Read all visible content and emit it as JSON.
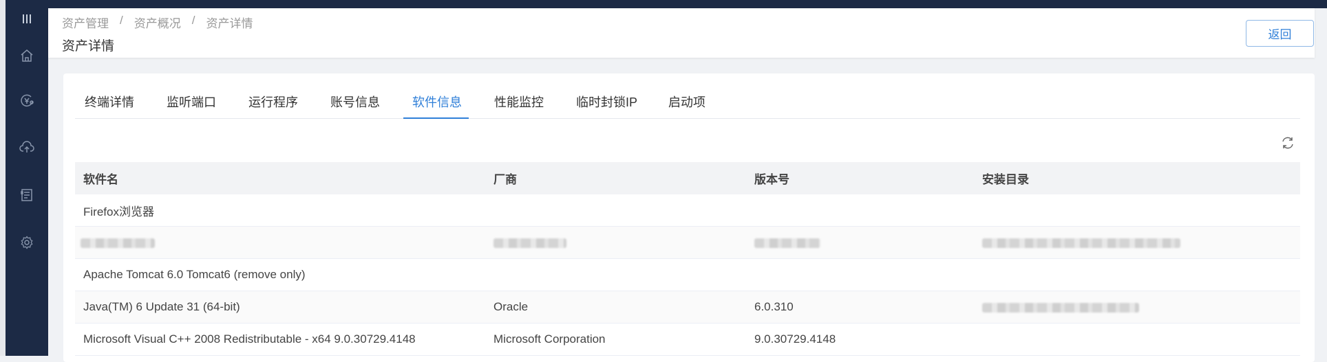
{
  "breadcrumb": [
    "资产管理",
    "资产概况",
    "资产详情"
  ],
  "breadcrumb_sep": "/",
  "page_title": "资产详情",
  "back_label": "返回",
  "sidebar_icons": [
    "menu-icon",
    "home-icon",
    "asset-icon",
    "upload-icon",
    "report-icon",
    "settings-icon"
  ],
  "tabs": [
    {
      "label": "终端详情",
      "active": false
    },
    {
      "label": "监听端口",
      "active": false
    },
    {
      "label": "运行程序",
      "active": false
    },
    {
      "label": "账号信息",
      "active": false
    },
    {
      "label": "软件信息",
      "active": true
    },
    {
      "label": "性能监控",
      "active": false
    },
    {
      "label": "临时封锁IP",
      "active": false
    },
    {
      "label": "启动项",
      "active": false
    }
  ],
  "table": {
    "headers": [
      "软件名",
      "厂商",
      "版本号",
      "安装目录"
    ],
    "rows": [
      [
        "Firefox浏览器",
        "",
        "",
        ""
      ],
      [
        "",
        "",
        "",
        ""
      ],
      [
        "Apache Tomcat 6.0 Tomcat6 (remove only)",
        "",
        "",
        ""
      ],
      [
        "Java(TM) 6 Update 31 (64-bit)",
        "Oracle",
        "6.0.310",
        ""
      ],
      [
        "Microsoft Visual C++ 2008 Redistributable - x64 9.0.30729.4148",
        "Microsoft Corporation",
        "9.0.30729.4148",
        ""
      ]
    ]
  },
  "colors": {
    "accent": "#2f7fd8",
    "sidebar": "#1c2a45"
  }
}
